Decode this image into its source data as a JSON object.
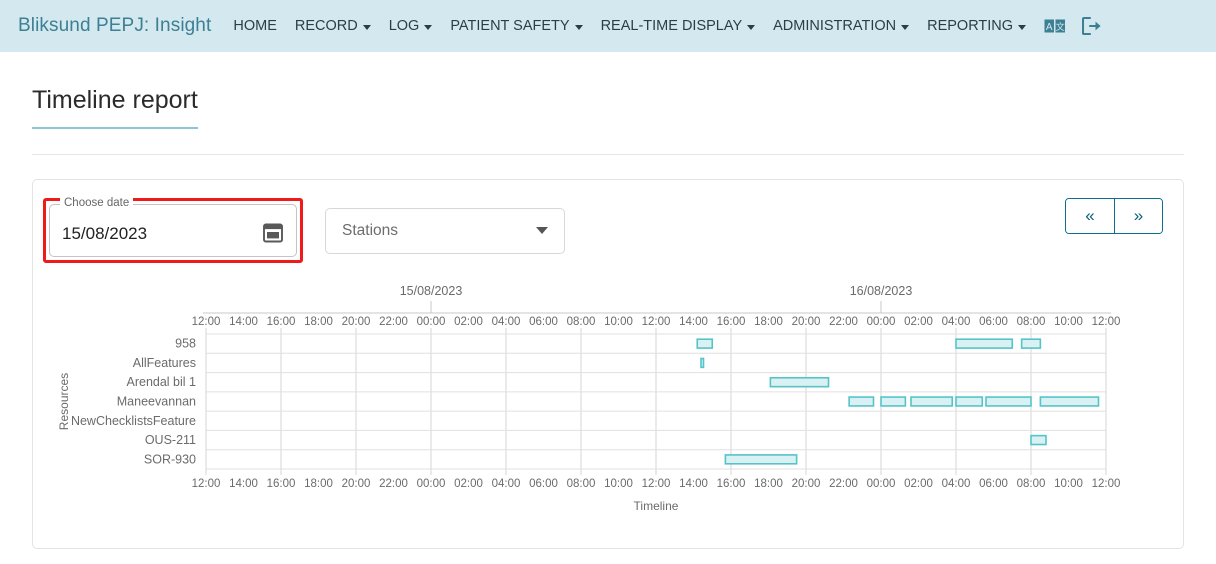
{
  "navbar": {
    "brand": "Bliksund PEPJ: Insight",
    "items": [
      {
        "label": "HOME",
        "has_caret": false
      },
      {
        "label": "RECORD",
        "has_caret": true
      },
      {
        "label": "LOG",
        "has_caret": true
      },
      {
        "label": "PATIENT SAFETY",
        "has_caret": true
      },
      {
        "label": "REAL-TIME DISPLAY",
        "has_caret": true
      },
      {
        "label": "ADMINISTRATION",
        "has_caret": true
      },
      {
        "label": "REPORTING",
        "has_caret": true
      }
    ],
    "icons": [
      {
        "name": "language-icon"
      },
      {
        "name": "logout-icon"
      }
    ],
    "bg_color": "#d3e9ef",
    "brand_color": "#3d7f93"
  },
  "page": {
    "title": "Timeline report"
  },
  "controls": {
    "date_label": "Choose date",
    "date_value": "15/08/2023",
    "date_highlight_color": "#ef1b1b",
    "calendar_icon": "calendar-icon",
    "station_select_value": "Stations",
    "prev_label": "«",
    "next_label": "»"
  },
  "chart_data": {
    "type": "bar",
    "title": "",
    "xlabel": "Timeline",
    "ylabel": "Resources",
    "grid": true,
    "legend": "none",
    "bar_fill": "#d9f1f2",
    "bar_stroke": "#55c4c8",
    "date_headers": [
      {
        "label": "15/08/2023",
        "tick_hour": 12
      },
      {
        "label": "16/08/2023",
        "tick_hour": 36
      }
    ],
    "x_ticks": [
      "12:00",
      "14:00",
      "16:00",
      "18:00",
      "20:00",
      "22:00",
      "00:00",
      "02:00",
      "04:00",
      "06:00",
      "08:00",
      "10:00",
      "12:00",
      "14:00",
      "16:00",
      "18:00",
      "20:00",
      "22:00",
      "00:00",
      "02:00",
      "04:00",
      "06:00",
      "08:00",
      "10:00",
      "12:00"
    ],
    "x_range_hours": [
      0,
      48
    ],
    "categories": [
      "958",
      "AllFeatures",
      "Arendal bil 1",
      "Maneevannan",
      "NewChecklistsFeature",
      "OUS-211",
      "SOR-930"
    ],
    "series": [
      {
        "name": "958",
        "row": 0,
        "bars": [
          {
            "start_hour": 26.2,
            "end_hour": 27.0
          },
          {
            "start_hour": 40.0,
            "end_hour": 43.0
          },
          {
            "start_hour": 43.5,
            "end_hour": 44.5
          }
        ]
      },
      {
        "name": "AllFeatures",
        "row": 1,
        "bars": [
          {
            "start_hour": 26.4,
            "end_hour": 26.5
          }
        ]
      },
      {
        "name": "Arendal bil 1",
        "row": 2,
        "bars": [
          {
            "start_hour": 30.1,
            "end_hour": 33.2
          }
        ]
      },
      {
        "name": "Maneevannan",
        "row": 3,
        "bars": [
          {
            "start_hour": 34.3,
            "end_hour": 35.6
          },
          {
            "start_hour": 36.0,
            "end_hour": 37.3
          },
          {
            "start_hour": 37.6,
            "end_hour": 39.8
          },
          {
            "start_hour": 40.0,
            "end_hour": 41.4
          },
          {
            "start_hour": 41.6,
            "end_hour": 44.0
          },
          {
            "start_hour": 44.5,
            "end_hour": 47.6
          }
        ]
      },
      {
        "name": "NewChecklistsFeature",
        "row": 4,
        "bars": []
      },
      {
        "name": "OUS-211",
        "row": 5,
        "bars": [
          {
            "start_hour": 44.0,
            "end_hour": 44.8
          }
        ]
      },
      {
        "name": "SOR-930",
        "row": 6,
        "bars": [
          {
            "start_hour": 27.7,
            "end_hour": 31.5
          }
        ]
      }
    ]
  }
}
